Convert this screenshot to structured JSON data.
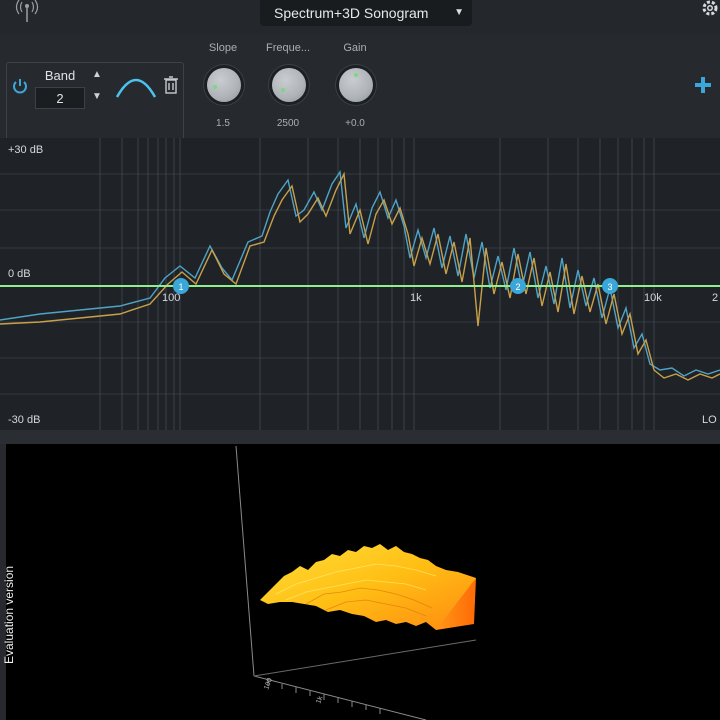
{
  "header": {
    "view_selector": "Spectrum+3D Sonogram",
    "icons": [
      "antenna-icon",
      "chevron-down-icon",
      "gear-icon"
    ]
  },
  "band_panel": {
    "band_label": "Band",
    "band_value": "2",
    "filter_shape": "bell",
    "icons": [
      "power-icon",
      "up-arrow-icon",
      "down-arrow-icon",
      "bell-curve-icon",
      "trash-icon"
    ]
  },
  "knobs": [
    {
      "label": "Slope",
      "value": "1.5"
    },
    {
      "label": "Freque...",
      "value": "2500"
    },
    {
      "label": "Gain",
      "value": "+0.0"
    }
  ],
  "spectrum": {
    "db_labels": {
      "top": "+30 dB",
      "mid": "0 dB",
      "bottom": "-30 dB"
    },
    "freq_labels": [
      "100",
      "1k",
      "10k",
      "2"
    ],
    "corner_label": "LO",
    "band_markers": [
      "1",
      "2",
      "3"
    ],
    "colors": {
      "eq_curve": "#8ef08a",
      "series_a": "#4fa3c7",
      "series_b": "#c8a04a",
      "marker": "#3aa7d8"
    }
  },
  "sonogram": {
    "watermark": "Evaluation version",
    "axis_ticks": [
      "100",
      "1k"
    ],
    "colors": {
      "surface_light": "#ffd21c",
      "surface_dark": "#ff7a0a"
    }
  }
}
